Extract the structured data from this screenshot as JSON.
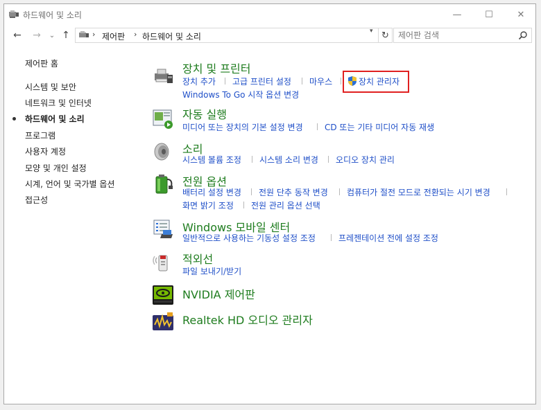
{
  "window": {
    "title": "하드웨어 및 소리",
    "minimize_glyph": "—",
    "maximize_glyph": "☐",
    "close_glyph": "✕"
  },
  "nav": {
    "back_glyph": "←",
    "forward_glyph": "→",
    "recent_glyph": "⌄",
    "up_glyph": "↑",
    "breadcrumb": [
      "제어판",
      "하드웨어 및 소리"
    ],
    "refresh_glyph": "↻"
  },
  "search": {
    "placeholder": "제어판 검색"
  },
  "sidebar": {
    "home": "제어판 홈",
    "items": [
      {
        "label": "시스템 및 보안"
      },
      {
        "label": "네트워크 및 인터넷"
      },
      {
        "label": "하드웨어 및 소리"
      },
      {
        "label": "프로그램"
      },
      {
        "label": "사용자 계정"
      },
      {
        "label": "모양 및 개인 설정"
      },
      {
        "label": "시계, 언어 및 국가별 옵션"
      },
      {
        "label": "접근성"
      }
    ],
    "active_index": 2
  },
  "categories": [
    {
      "title": "장치 및 프린터",
      "links": [
        "장치 추가",
        "고급 프린터 설정",
        "마우스",
        "장치 관리자",
        "Windows To Go 시작 옵션 변경"
      ]
    },
    {
      "title": "자동 실행",
      "links": [
        "미디어 또는 장치의 기본 설정 변경",
        "CD 또는 기타 미디어 자동 재생"
      ]
    },
    {
      "title": "소리",
      "links": [
        "시스템 볼륨 조정",
        "시스템 소리 변경",
        "오디오 장치 관리"
      ]
    },
    {
      "title": "전원 옵션",
      "links": [
        "배터리 설정 변경",
        "전원 단추 동작 변경",
        "컴퓨터가 절전 모드로 전환되는 시기 변경",
        "화면 밝기 조정",
        "전원 관리 옵션 선택"
      ]
    },
    {
      "title": "Windows 모바일 센터",
      "links": [
        "일반적으로 사용하는 기동성 설정 조정",
        "프레젠테이션 전에 설정 조정"
      ]
    },
    {
      "title": "적외선",
      "links": [
        "파일 보내기/받기"
      ]
    },
    {
      "title": "NVIDIA 제어판",
      "links": []
    },
    {
      "title": "Realtek HD 오디오 관리자",
      "links": []
    }
  ],
  "colors": {
    "category_title": "#1e7c1e",
    "link": "#1f4fc8",
    "highlight_border": "#e02020"
  }
}
